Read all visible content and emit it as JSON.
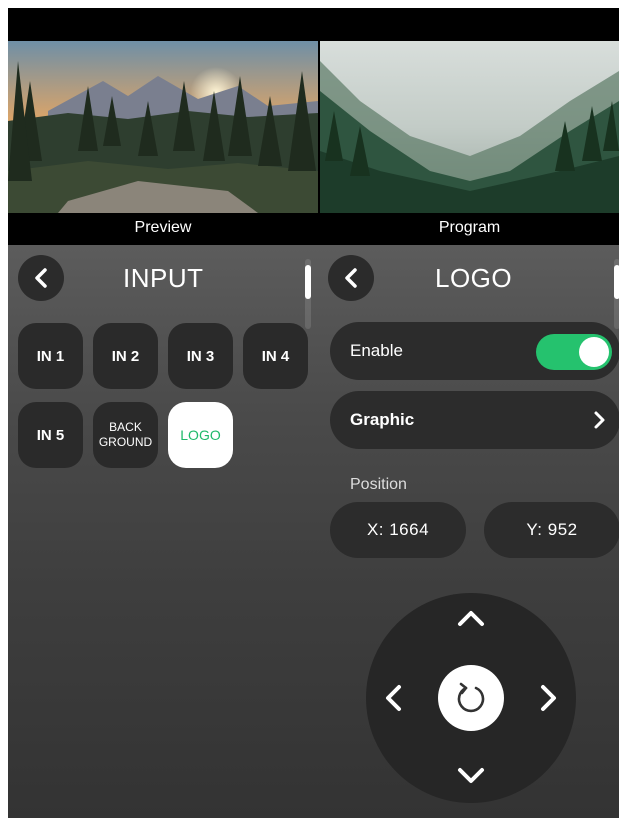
{
  "preview": {
    "label": "Preview"
  },
  "program": {
    "label": "Program"
  },
  "input_panel": {
    "title": "INPUT",
    "buttons": [
      {
        "label": "IN 1"
      },
      {
        "label": "IN 2"
      },
      {
        "label": "IN 3"
      },
      {
        "label": "IN 4"
      },
      {
        "label": "IN 5"
      },
      {
        "label": "BACK GROUND"
      },
      {
        "label": "LOGO",
        "selected": true
      }
    ]
  },
  "logo_panel": {
    "title": "LOGO",
    "enable_label": "Enable",
    "enable_on": true,
    "graphic_label": "Graphic",
    "position_label": "Position",
    "x_text": "X:  1664",
    "y_text": "Y:  952"
  },
  "colors": {
    "accent_green": "#25c26e",
    "logo_text_green": "#1fb96a",
    "button_dark": "#2a2a2a"
  },
  "icons": {
    "back": "chevron-left-icon",
    "graphic_nav": "chevron-right-icon",
    "dpad_up": "chevron-up-icon",
    "dpad_down": "chevron-down-icon",
    "dpad_left": "chevron-left-icon",
    "dpad_right": "chevron-right-icon",
    "reset": "reset-icon"
  }
}
